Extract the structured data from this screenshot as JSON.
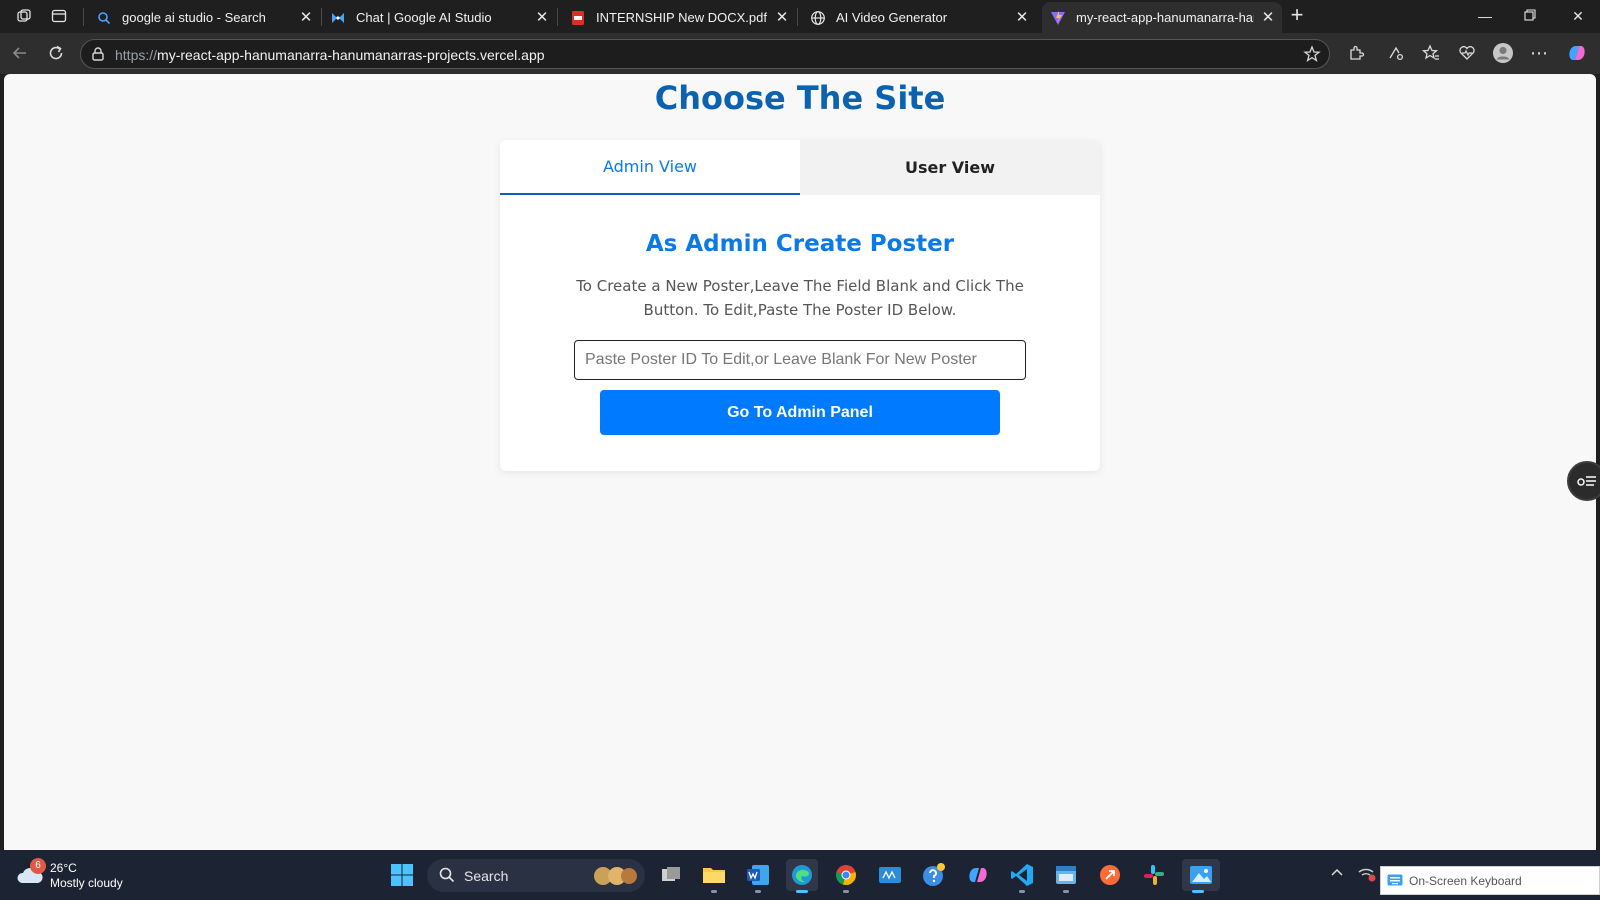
{
  "browser": {
    "tabs": [
      {
        "label": "google ai studio - Search",
        "favicon": "search-icon"
      },
      {
        "label": "Chat | Google AI Studio",
        "favicon": "ai-studio-icon"
      },
      {
        "label": "INTERNSHIP New DOCX.pdf",
        "favicon": "pdf-icon"
      },
      {
        "label": "AI Video Generator",
        "favicon": "globe-icon"
      },
      {
        "label": "my-react-app-hanumanarra-hanu",
        "favicon": "vite-icon",
        "active": true
      }
    ],
    "address": {
      "scheme": "https://",
      "host": "my-react-app-hanumanarra-hanumanarras-projects.vercel.app"
    }
  },
  "page": {
    "title": "Choose The Site",
    "tabs": [
      {
        "label": "Admin View",
        "active": true
      },
      {
        "label": "User View",
        "active": false
      }
    ],
    "heading": "As Admin Create Poster",
    "description": "To Create a New Poster,Leave The Field Blank and Click The Button. To Edit,Paste The Poster ID Below.",
    "input": {
      "value": "",
      "placeholder": "Paste Poster ID To Edit,or Leave Blank For New Poster"
    },
    "button_label": "Go To Admin Panel"
  },
  "taskbar": {
    "weather": {
      "temp": "26°C",
      "condition": "Mostly cloudy",
      "badge": "6"
    },
    "search_label": "Search",
    "osk_label": "On-Screen Keyboard"
  },
  "colors": {
    "title": "#0b62b0",
    "accent": "#0b79e6",
    "button": "#007bff",
    "taskbar": "#1c2333"
  }
}
